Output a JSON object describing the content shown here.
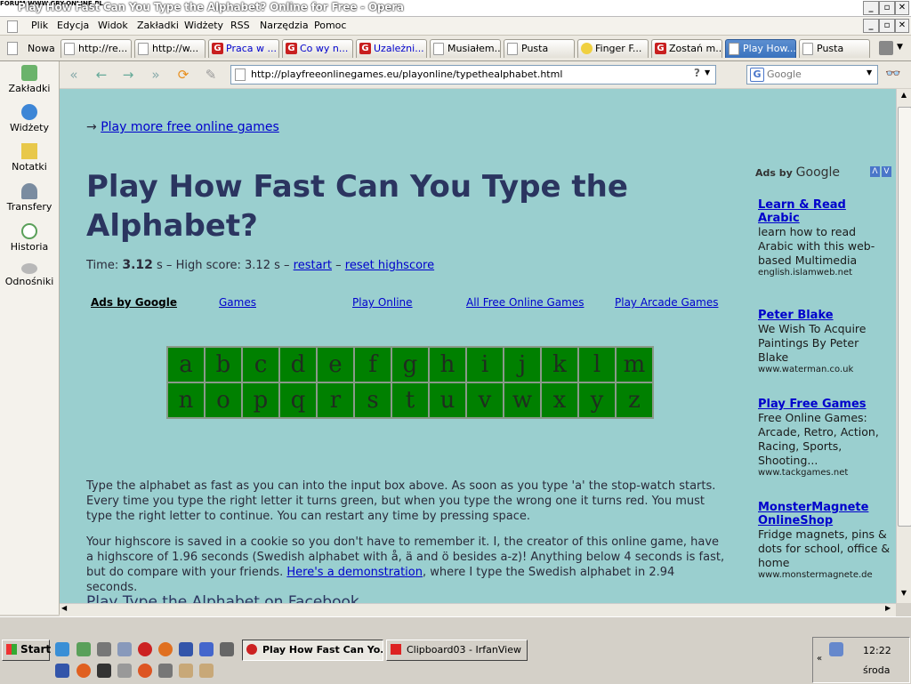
{
  "window": {
    "watermark": "FORUM WWW.GRY-ONLINE.PL",
    "title": "Play How Fast Can You Type the Alphabet? Online for Free - Opera"
  },
  "menu": [
    "Plik",
    "Edycja",
    "Widok",
    "Zakładki",
    "Widżety",
    "RSS",
    "Narzędzia",
    "Pomoc"
  ],
  "tabs": {
    "new_label": "Nowa",
    "items": [
      {
        "label": "http://re...",
        "icon": "page-icon"
      },
      {
        "label": "http://w...",
        "icon": "page-icon"
      },
      {
        "label": "Praca w ...",
        "icon": "g-icon"
      },
      {
        "label": "Co wy n...",
        "icon": "g-icon"
      },
      {
        "label": "Uzależni...",
        "icon": "g-icon"
      },
      {
        "label": "Musiałem...",
        "icon": "page-icon"
      },
      {
        "label": "Pusta",
        "icon": "page-icon"
      },
      {
        "label": "Finger F...",
        "icon": "smile-icon"
      },
      {
        "label": "Zostań m...",
        "icon": "g-icon"
      },
      {
        "label": "Play How...",
        "icon": "page-icon"
      },
      {
        "label": "Pusta",
        "icon": "page-icon"
      }
    ]
  },
  "sidepanel": [
    "Zakładki",
    "Widżety",
    "Notatki",
    "Transfery",
    "Historia",
    "Odnośniki"
  ],
  "address": {
    "url": "http://playfreeonlinegames.eu/playonline/typethealphabet.html",
    "search_placeholder": "Google"
  },
  "page": {
    "more_prefix": "→",
    "more_link": "Play more free online games",
    "heading": "Play How Fast Can You Type the Alphabet?",
    "time_label": "Time:",
    "time_value": "3.12",
    "time_unit": "s – High score: 3.12 s –",
    "restart": "restart",
    "dash": "–",
    "reset": "reset highscore",
    "ads_label": "Ads by Google",
    "ad_links": [
      "Games",
      "Play Online",
      "All Free Online Games",
      "Play Arcade Games"
    ],
    "letters_row1": [
      "a",
      "b",
      "c",
      "d",
      "e",
      "f",
      "g",
      "h",
      "i",
      "j",
      "k",
      "l",
      "m"
    ],
    "letters_row2": [
      "n",
      "o",
      "p",
      "q",
      "r",
      "s",
      "t",
      "u",
      "v",
      "w",
      "x",
      "y",
      "z"
    ],
    "para1": "Type the alphabet as fast as you can into the input box above. As soon as you type 'a' the stop-watch starts. Every time you type the right letter it turns green, but when you type the wrong one it turns red. You must type the right letter to continue. You can restart any time by pressing space.",
    "para2_a": "Your highscore is saved in a cookie so you don't have to remember it. I, the creator of this online game, have a highscore of 1.96 seconds (Swedish alphabet with å, ä and ö besides a-z)! Anything below 4 seconds is fast, but do compare with your friends.",
    "para2_link": "Here's a demonstration",
    "para2_b": ", where I type the Swedish alphabet in 2.94 seconds.",
    "sub_heading": "Play Type the Alphabet on Facebook"
  },
  "sidebar_ads": {
    "header": "Ads by",
    "header_brand": "Google",
    "items": [
      {
        "title": "Learn & Read Arabic",
        "text": "learn how to read Arabic with this web-based Multimedia",
        "url": "english.islamweb.net"
      },
      {
        "title": "Peter Blake",
        "text": "We Wish To Acquire Paintings By Peter Blake",
        "url": "www.waterman.co.uk"
      },
      {
        "title": "Play Free Games",
        "text": "Free Online Games: Arcade, Retro, Action, Racing, Sports, Shooting...",
        "url": "www.tackgames.net"
      },
      {
        "title": "MonsterMagnete OnlineShop",
        "text": "Fridge magnets, pins & dots for school, office & home",
        "url": "www.monstermagnete.de"
      }
    ]
  },
  "taskbar": {
    "start": "Start",
    "items": [
      "Play How Fast Can Yo...",
      "Clipboard03 - IrfanView"
    ],
    "clock": "12:22",
    "day": "środa"
  }
}
